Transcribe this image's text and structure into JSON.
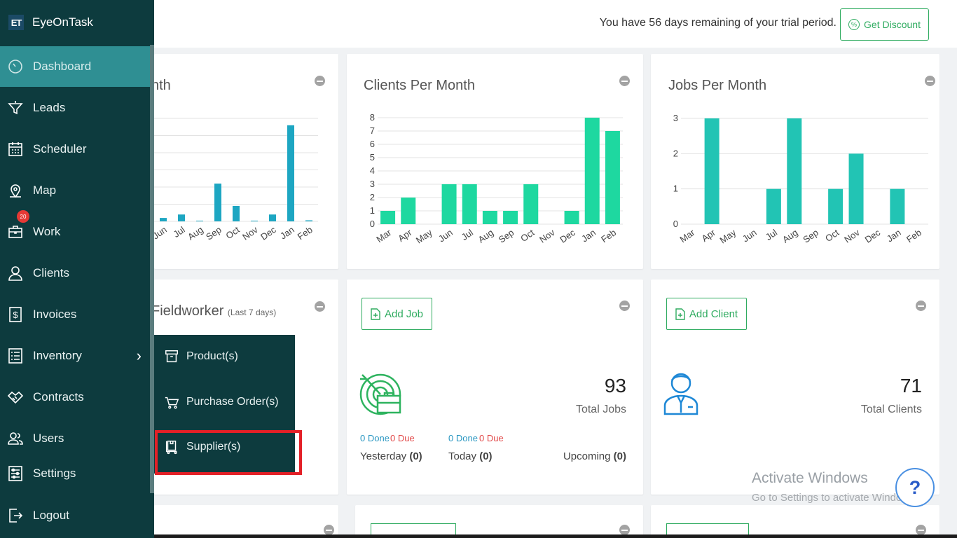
{
  "brand": {
    "logo": "ET",
    "name": "EyeOnTask"
  },
  "sidebar": {
    "items": [
      {
        "label": "Dashboard",
        "icon": "dashboard-icon"
      },
      {
        "label": "Leads",
        "icon": "funnel-icon"
      },
      {
        "label": "Scheduler",
        "icon": "calendar-icon"
      },
      {
        "label": "Map",
        "icon": "map-pin-icon"
      },
      {
        "label": "Work",
        "icon": "briefcase-icon",
        "badge": "20"
      },
      {
        "label": "Clients",
        "icon": "user-icon"
      },
      {
        "label": "Invoices",
        "icon": "dollar-icon"
      },
      {
        "label": "Inventory",
        "icon": "list-icon"
      },
      {
        "label": "Contracts",
        "icon": "handshake-icon"
      },
      {
        "label": "Users",
        "icon": "users-icon"
      },
      {
        "label": "Settings",
        "icon": "sliders-icon"
      },
      {
        "label": "Logout",
        "icon": "logout-icon"
      }
    ]
  },
  "inventory_menu": {
    "items": [
      {
        "label": "Product(s)",
        "icon": "box-icon"
      },
      {
        "label": "Purchase Order(s)",
        "icon": "cart-icon"
      },
      {
        "label": "Supplier(s)",
        "icon": "trolley-icon"
      }
    ]
  },
  "topbar": {
    "trial_text": "You have 56 days remaining of your trial period.",
    "discount_label": "Get Discount"
  },
  "cards": {
    "partial_chart_title": "nth",
    "clients_title": "Clients Per Month",
    "jobs_title": "Jobs Per Month",
    "fieldworker_title": "Fieldworker",
    "fieldworker_sub": "(Last 7 days)",
    "add_job": "Add Job",
    "add_client": "Add Client",
    "total_jobs_value": "93",
    "total_jobs_label": "Total Jobs",
    "total_clients_value": "71",
    "total_clients_label": "Total Clients",
    "yesterday_done": "0 Done",
    "yesterday_due": "0 Due",
    "today_done": "0 Done",
    "today_due": "0 Due",
    "yesterday_label": "Yesterday",
    "yesterday_count": "(0)",
    "today_label": "Today",
    "today_count": "(0)",
    "upcoming_label": "Upcoming",
    "upcoming_count": "(0)"
  },
  "watermark": {
    "line1": "Activate Windows",
    "line2": "Go to Settings to activate Windows."
  },
  "help_label": "?",
  "colors": {
    "sidebar": "#0d3b3e",
    "active": "#2f8f93",
    "accent": "#2eab5f",
    "bar_clients": "#1ed8a0",
    "bar_jobs": "#22c4b4",
    "bar_partial": "#1da6c2"
  },
  "chart_data": [
    {
      "type": "bar",
      "categories": [
        "Jun",
        "Jul",
        "Aug",
        "Sep",
        "Oct",
        "Nov",
        "Dec",
        "Jan",
        "Feb"
      ],
      "values": [
        1,
        2,
        0.2,
        11,
        4.5,
        0.2,
        2,
        28,
        0.3
      ]
    },
    {
      "type": "bar",
      "title": "Clients Per Month",
      "categories": [
        "Mar",
        "Apr",
        "May",
        "Jun",
        "Jul",
        "Aug",
        "Sep",
        "Oct",
        "Nov",
        "Dec",
        "Jan",
        "Feb"
      ],
      "values": [
        1,
        2,
        0,
        3,
        3,
        1,
        1,
        3,
        0,
        1,
        8,
        7
      ],
      "ylim": [
        0,
        8
      ],
      "yticks": [
        "0",
        "1",
        "2",
        "3",
        "4",
        "5",
        "6",
        "7",
        "8"
      ]
    },
    {
      "type": "bar",
      "title": "Jobs Per Month",
      "categories": [
        "Mar",
        "Apr",
        "May",
        "Jun",
        "Jul",
        "Aug",
        "Sep",
        "Oct",
        "Nov",
        "Dec",
        "Jan",
        "Feb"
      ],
      "values": [
        0,
        3,
        0,
        0,
        1,
        3,
        0,
        1,
        2,
        0,
        1,
        0
      ],
      "ylim": [
        0,
        3
      ],
      "yticks": [
        "0",
        "1",
        "2",
        "3"
      ]
    }
  ]
}
